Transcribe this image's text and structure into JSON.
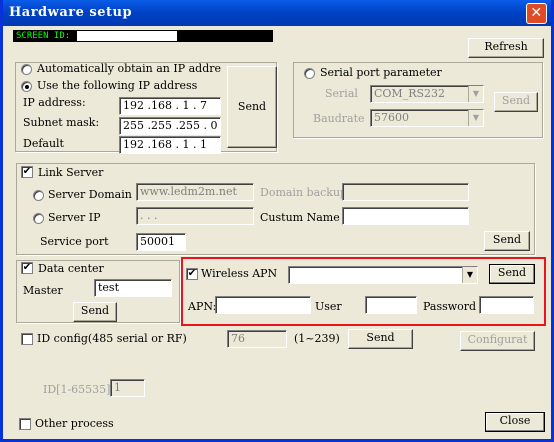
{
  "window": {
    "title": "Hardware setup",
    "close_glyph": "✕",
    "screen_id_label": "SCREEN ID:",
    "refresh_label": "Refresh",
    "close_label": "Close"
  },
  "ip": {
    "auto_label": "Automatically obtain an IP addre",
    "manual_label": "Use the following IP address",
    "ip_label": "IP address:",
    "ip_value": "192 .168 . 1  . 7",
    "mask_label": "Subnet mask:",
    "mask_value": "255 .255 .255 . 0",
    "default_label": "Default",
    "default_value": "192 .168 . 1  . 1",
    "send_label": "Send"
  },
  "serial": {
    "title": "Serial port parameter",
    "serial_label": "Serial",
    "serial_value": "COM_RS232",
    "baud_label": "Baudrate",
    "baud_value": "57600",
    "send_label": "Send"
  },
  "link": {
    "title": "Link Server",
    "domain_label": "Server Domain",
    "domain_value": "www.ledm2m.net",
    "backup_label": "Domain backup",
    "ip_label": "Server IP",
    "ip_value": "  .   .   .  ",
    "custum_label": "Custum Name",
    "port_label": "Service port",
    "port_value": "50001",
    "send_label": "Send"
  },
  "data_center": {
    "title": "Data center",
    "master_label": "Master",
    "master_value": "test",
    "send_label": "Send"
  },
  "apn": {
    "title": "Wireless APN",
    "send_label": "Send",
    "apn_label": "APN:",
    "user_label": "User",
    "password_label": "Password"
  },
  "id_config": {
    "label": "ID config(485 serial or RF)",
    "value": "76",
    "range": "(1~239)",
    "send_label": "Send",
    "configurat_label": "Configurat",
    "id_range_label": "ID[1-65535]",
    "id_value": "1"
  },
  "other": {
    "label": "Other process"
  },
  "colors": {
    "titlebar": "#0a5ce6",
    "highlight": "#e8141e",
    "window_bg": "#ece9d8"
  }
}
